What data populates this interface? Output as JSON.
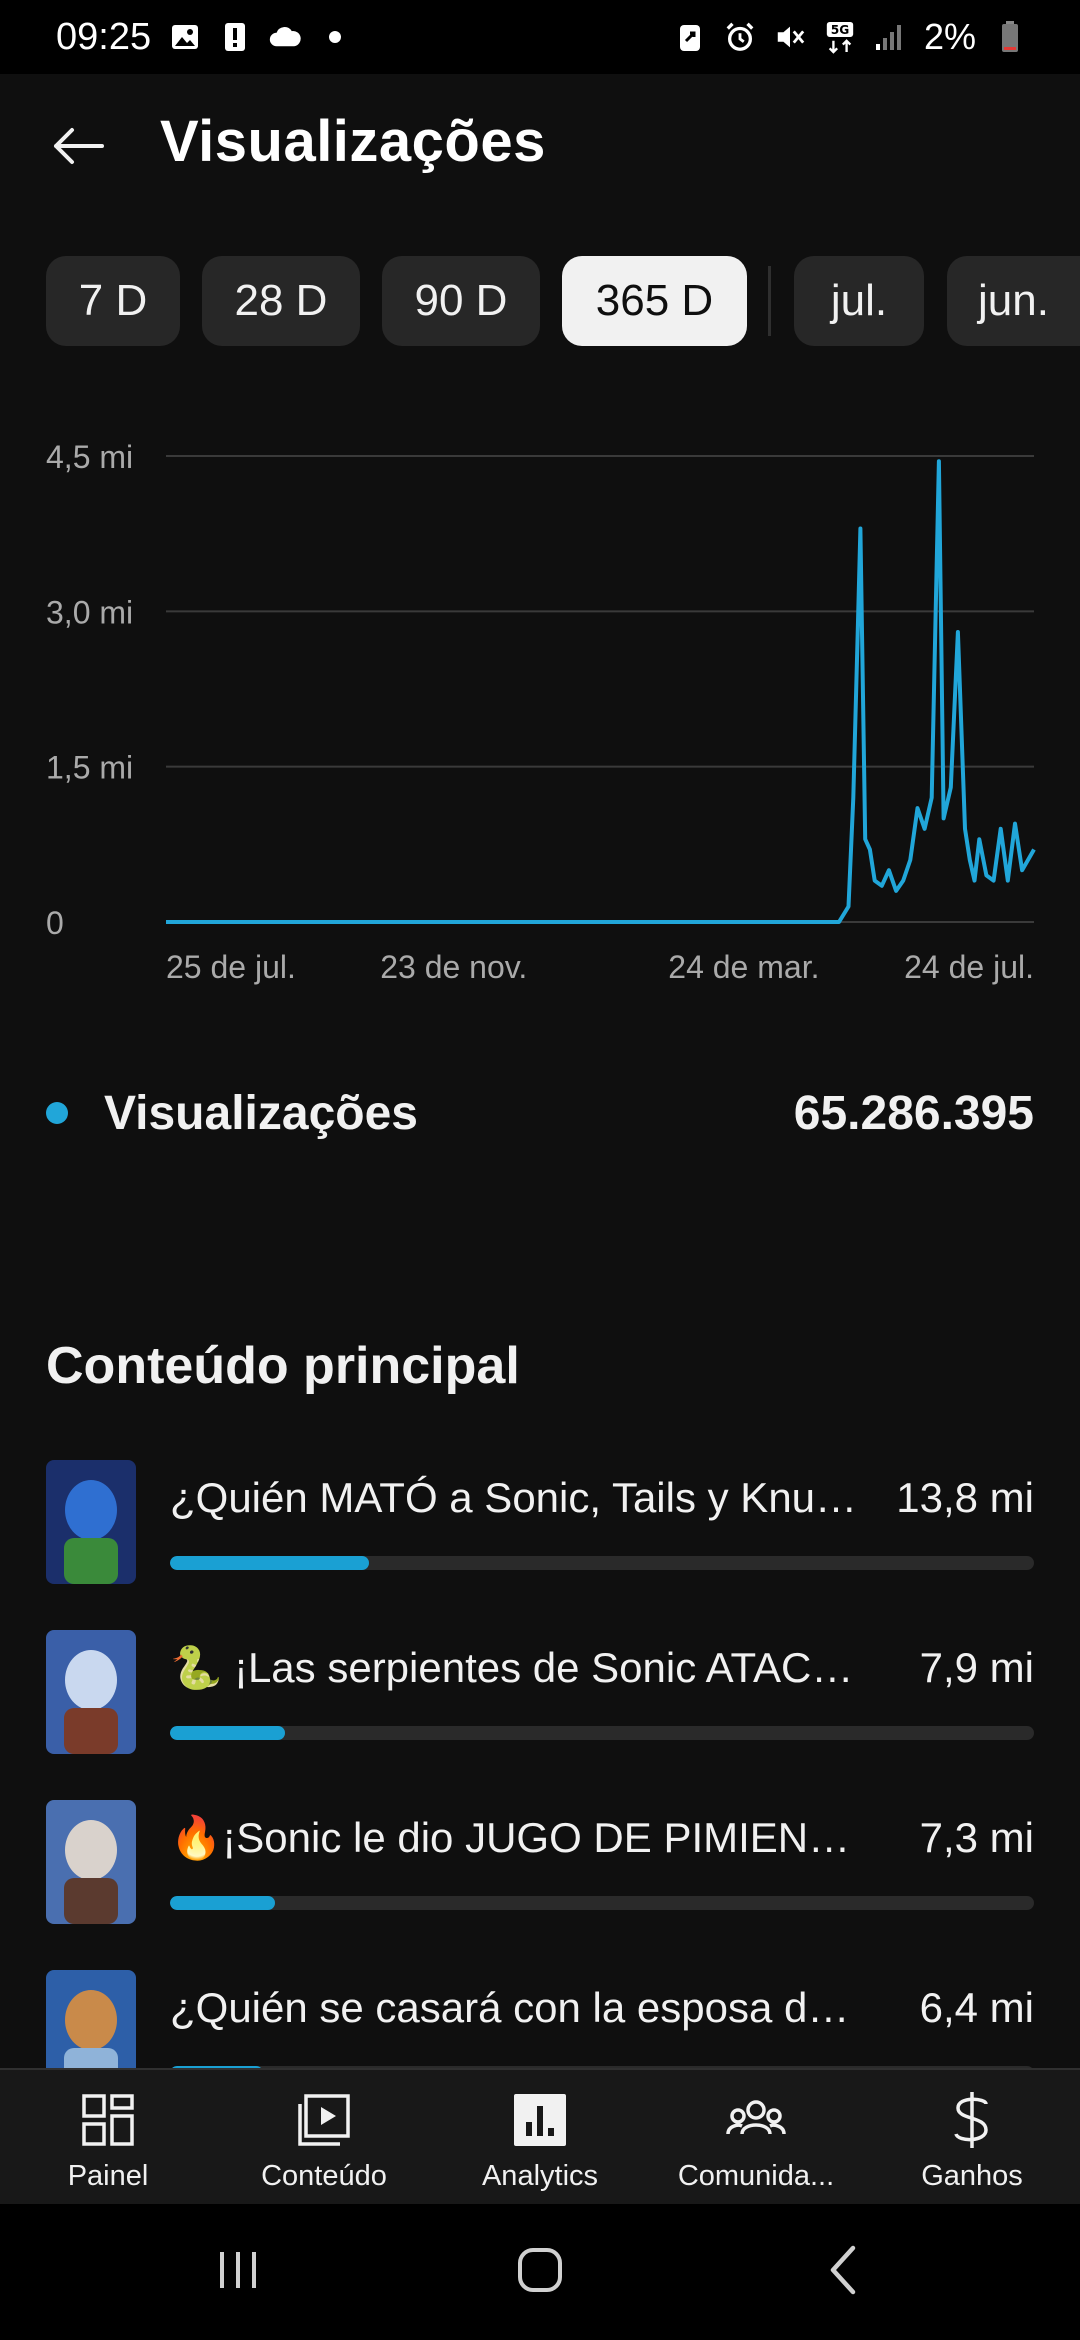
{
  "status_bar": {
    "time": "09:25",
    "left_icons": [
      "image-icon",
      "alert-icon",
      "cloud-icon",
      "dot-icon"
    ],
    "right_icons": [
      "battery-saver-icon",
      "alarm-icon",
      "mute-icon",
      "5g-icon",
      "signal-icon"
    ],
    "battery_text": "2%"
  },
  "header": {
    "title": "Visualizações",
    "back_icon": "arrow-left-icon"
  },
  "period_chips": [
    {
      "label": "7 D",
      "selected": false
    },
    {
      "label": "28 D",
      "selected": false
    },
    {
      "label": "90 D",
      "selected": false
    },
    {
      "label": "365 D",
      "selected": true
    },
    {
      "label": "jul.",
      "selected": false
    },
    {
      "label": "jun.",
      "selected": false
    }
  ],
  "chart_data": {
    "type": "line",
    "title": "",
    "xlabel": "",
    "ylabel": "",
    "y_unit": "mi",
    "ylim": [
      0,
      4.5
    ],
    "y_ticks": [
      0,
      1.5,
      3.0,
      4.5
    ],
    "y_tick_labels": [
      "0",
      "1,5 mi",
      "3,0 mi",
      "4,5 mi"
    ],
    "x_tick_labels": [
      "25 de jul.",
      "23 de nov.",
      "24 de mar.",
      "24 de jul."
    ],
    "grid": true,
    "color": "#21a6d9",
    "series": [
      {
        "x": [
          "25 de jul.",
          "23 de nov.",
          "24 de mar.",
          "2024-05-03",
          "2024-05-07",
          "2024-05-09",
          "2024-05-11",
          "2024-05-12",
          "2024-05-14",
          "2024-05-16",
          "2024-05-18",
          "2024-05-21",
          "2024-05-24",
          "2024-05-27",
          "2024-05-30",
          "2024-06-02",
          "2024-06-05",
          "2024-06-08",
          "2024-06-11",
          "2024-06-14",
          "2024-06-16",
          "2024-06-19",
          "2024-06-22",
          "2024-06-25",
          "2024-06-27",
          "2024-06-29",
          "2024-07-01",
          "2024-07-04",
          "2024-07-07",
          "2024-07-10",
          "2024-07-13",
          "2024-07-16",
          "2024-07-19",
          "24 de jul."
        ],
        "values": [
          0.0,
          0.0,
          0.0,
          0.0,
          0.15,
          1.2,
          2.9,
          3.8,
          0.8,
          0.7,
          0.4,
          0.35,
          0.5,
          0.3,
          0.4,
          0.6,
          1.1,
          0.9,
          1.2,
          4.45,
          1.0,
          1.3,
          2.8,
          0.9,
          0.6,
          0.4,
          0.8,
          0.45,
          0.4,
          0.9,
          0.4,
          0.95,
          0.5,
          0.7
        ]
      }
    ]
  },
  "legend": {
    "label": "Visualizações",
    "value": "65.286.395",
    "color": "#21a6d9"
  },
  "top_content": {
    "title": "Conteúdo principal",
    "items": [
      {
        "title": "¿Quién MATÓ a Sonic, Tails y Knuckles?",
        "value": "13,8 mi",
        "value_num": 13.8,
        "bar_fraction": 0.23,
        "thumb_colors": [
          "#1b2f6b",
          "#2f6fd1",
          "#3a8a3a"
        ]
      },
      {
        "title": "🐍 ¡Las serpientes de Sonic ATACAN!",
        "value": "7,9 mi",
        "value_num": 7.9,
        "bar_fraction": 0.133,
        "thumb_colors": [
          "#3a5fa8",
          "#c9d8ef",
          "#7a3b2a"
        ]
      },
      {
        "title": "🔥¡Sonic le dio JUGO DE PIMIENTA!",
        "value": "7,3 mi",
        "value_num": 7.3,
        "bar_fraction": 0.122,
        "thumb_colors": [
          "#4a6fb0",
          "#d9d2cc",
          "#5b3a2f"
        ]
      },
      {
        "title": "¿Quién se casará con la esposa de Sonic?",
        "value": "6,4 mi",
        "value_num": 6.4,
        "bar_fraction": 0.108,
        "thumb_colors": [
          "#2d5fa8",
          "#c98a4a",
          "#8fb3d9"
        ]
      }
    ]
  },
  "bottom_nav": [
    {
      "label": "Painel",
      "icon": "dashboard-icon",
      "active": false
    },
    {
      "label": "Conteúdo",
      "icon": "content-play-icon",
      "active": false
    },
    {
      "label": "Analytics",
      "icon": "analytics-icon",
      "active": true
    },
    {
      "label": "Comunida...",
      "icon": "community-icon",
      "active": false
    },
    {
      "label": "Ganhos",
      "icon": "dollar-icon",
      "active": false
    }
  ],
  "system_nav": [
    "recents-icon",
    "home-icon",
    "back-icon"
  ]
}
